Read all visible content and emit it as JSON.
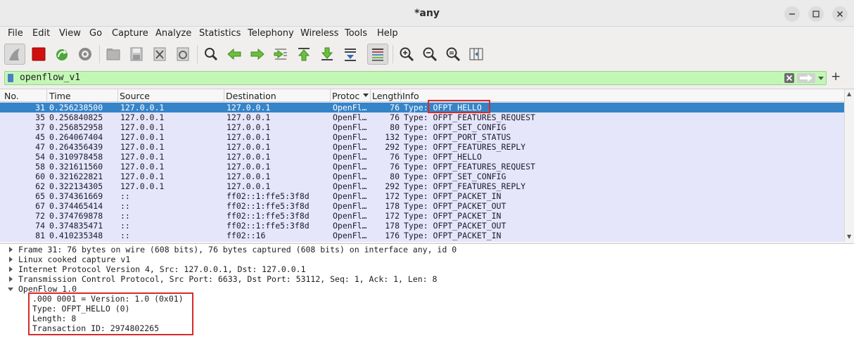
{
  "window": {
    "title": "*any"
  },
  "menu": [
    "File",
    "Edit",
    "View",
    "Go",
    "Capture",
    "Analyze",
    "Statistics",
    "Telephony",
    "Wireless",
    "Tools",
    "Help"
  ],
  "toolbar_icons": [
    "shark-fin-start-icon",
    "stop-capture-icon",
    "restart-capture-icon",
    "capture-options-icon",
    "open-file-icon",
    "save-file-icon",
    "close-file-icon",
    "reload-file-icon",
    "find-packet-icon",
    "go-back-icon",
    "go-forward-icon",
    "go-to-packet-icon",
    "go-first-icon",
    "go-last-icon",
    "autoscroll-icon",
    "colorize-icon",
    "zoom-in-icon",
    "zoom-out-icon",
    "normal-size-icon",
    "resize-columns-icon"
  ],
  "filter": {
    "value": "openflow_v1"
  },
  "columns": {
    "no": "No.",
    "time": "Time",
    "source": "Source",
    "destination": "Destination",
    "protocol": "Protoc",
    "length": "Length",
    "info": "Info"
  },
  "packets": [
    {
      "no": "31",
      "time": "0.256238500",
      "src": "127.0.0.1",
      "dst": "127.0.0.1",
      "proto": "OpenFl…",
      "len": "76",
      "info": "Type: OFPT_HELLO"
    },
    {
      "no": "35",
      "time": "0.256840825",
      "src": "127.0.0.1",
      "dst": "127.0.0.1",
      "proto": "OpenFl…",
      "len": "76",
      "info": "Type: OFPT_FEATURES_REQUEST"
    },
    {
      "no": "37",
      "time": "0.256852958",
      "src": "127.0.0.1",
      "dst": "127.0.0.1",
      "proto": "OpenFl…",
      "len": "80",
      "info": "Type: OFPT_SET_CONFIG"
    },
    {
      "no": "45",
      "time": "0.264067404",
      "src": "127.0.0.1",
      "dst": "127.0.0.1",
      "proto": "OpenFl…",
      "len": "132",
      "info": "Type: OFPT_PORT_STATUS"
    },
    {
      "no": "47",
      "time": "0.264356439",
      "src": "127.0.0.1",
      "dst": "127.0.0.1",
      "proto": "OpenFl…",
      "len": "292",
      "info": "Type: OFPT_FEATURES_REPLY"
    },
    {
      "no": "54",
      "time": "0.310978458",
      "src": "127.0.0.1",
      "dst": "127.0.0.1",
      "proto": "OpenFl…",
      "len": "76",
      "info": "Type: OFPT_HELLO"
    },
    {
      "no": "58",
      "time": "0.321611560",
      "src": "127.0.0.1",
      "dst": "127.0.0.1",
      "proto": "OpenFl…",
      "len": "76",
      "info": "Type: OFPT_FEATURES_REQUEST"
    },
    {
      "no": "60",
      "time": "0.321622821",
      "src": "127.0.0.1",
      "dst": "127.0.0.1",
      "proto": "OpenFl…",
      "len": "80",
      "info": "Type: OFPT_SET_CONFIG"
    },
    {
      "no": "62",
      "time": "0.322134305",
      "src": "127.0.0.1",
      "dst": "127.0.0.1",
      "proto": "OpenFl…",
      "len": "292",
      "info": "Type: OFPT_FEATURES_REPLY"
    },
    {
      "no": "65",
      "time": "0.374361669",
      "src": "::",
      "dst": "ff02::1:ffe5:3f8d",
      "proto": "OpenFl…",
      "len": "172",
      "info": "Type: OFPT_PACKET_IN"
    },
    {
      "no": "67",
      "time": "0.374465414",
      "src": "::",
      "dst": "ff02::1:ffe5:3f8d",
      "proto": "OpenFl…",
      "len": "178",
      "info": "Type: OFPT_PACKET_OUT"
    },
    {
      "no": "72",
      "time": "0.374769878",
      "src": "::",
      "dst": "ff02::1:ffe5:3f8d",
      "proto": "OpenFl…",
      "len": "172",
      "info": "Type: OFPT_PACKET_IN"
    },
    {
      "no": "74",
      "time": "0.374835471",
      "src": "::",
      "dst": "ff02::1:ffe5:3f8d",
      "proto": "OpenFl…",
      "len": "178",
      "info": "Type: OFPT_PACKET_OUT"
    },
    {
      "no": "81",
      "time": "0.410235348",
      "src": "::",
      "dst": "ff02::16",
      "proto": "OpenFl…",
      "len": "176",
      "info": "Type: OFPT_PACKET_IN"
    }
  ],
  "details": [
    {
      "text": "Frame 31: 76 bytes on wire (608 bits), 76 bytes captured (608 bits) on interface any, id 0",
      "expanded": false
    },
    {
      "text": "Linux cooked capture v1",
      "expanded": false
    },
    {
      "text": "Internet Protocol Version 4, Src: 127.0.0.1, Dst: 127.0.0.1",
      "expanded": false
    },
    {
      "text": "Transmission Control Protocol, Src Port: 6633, Dst Port: 53112, Seq: 1, Ack: 1, Len: 8",
      "expanded": false
    },
    {
      "text": "OpenFlow 1.0",
      "expanded": true
    }
  ],
  "openflow_fields": [
    ".000 0001 = Version: 1.0 (0x01)",
    "Type: OFPT_HELLO (0)",
    "Length: 8",
    "Transaction ID: 2974802265"
  ],
  "colors": {
    "selected_row": "#3584c8",
    "row_bg": "#e6e6fa",
    "filter_bg": "#c3f7b5",
    "highlight": "#d82a2a"
  }
}
